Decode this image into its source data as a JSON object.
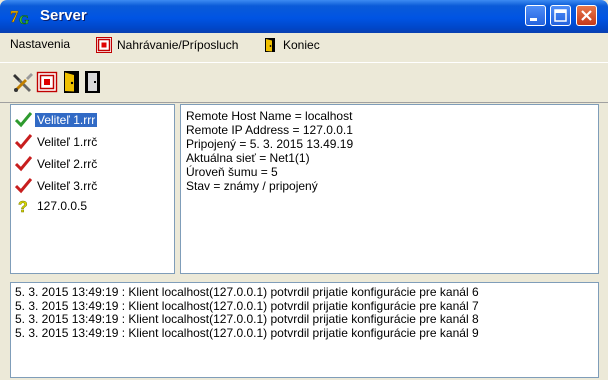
{
  "window": {
    "title": "Server"
  },
  "menu": {
    "settings": "Nastavenia",
    "recording": "Nahrávanie/Príposluch",
    "exit": "Koniec"
  },
  "toolbar": {
    "icons": [
      "tools-icon",
      "record-icon",
      "exit-door-icon",
      "door-icon"
    ]
  },
  "tree": [
    {
      "label": "Veliteľ 1.rrr",
      "icon": "check-icon",
      "selected": true
    },
    {
      "label": "Veliteľ 1.rrč",
      "icon": "check-icon"
    },
    {
      "label": "Veliteľ 2.rrč",
      "icon": "check-icon"
    },
    {
      "label": "Veliteľ 3.rrč",
      "icon": "check-icon"
    },
    {
      "label": "127.0.0.5",
      "icon": "question-icon"
    }
  ],
  "details": [
    "Remote Host Name = localhost",
    "Remote IP Address = 127.0.0.1",
    "Pripojený = 5. 3. 2015 13.49.19",
    "Aktuálna sieť = Net1(1)",
    "Úroveň šumu = 5",
    "Stav = známy / pripojený"
  ],
  "log": [
    "5. 3. 2015 13:49:19 : Klient localhost(127.0.0.1) potvrdil prijatie konfigurácie pre kanál 6",
    "5. 3. 2015 13:49:19 : Klient localhost(127.0.0.1) potvrdil prijatie konfigurácie pre kanál 7",
    "5. 3. 2015 13:49:19 : Klient localhost(127.0.0.1) potvrdil prijatie konfigurácie pre kanál 8",
    "5. 3. 2015 13:49:19 : Klient localhost(127.0.0.1) potvrdil prijatie konfigurácie pre kanál 9"
  ]
}
